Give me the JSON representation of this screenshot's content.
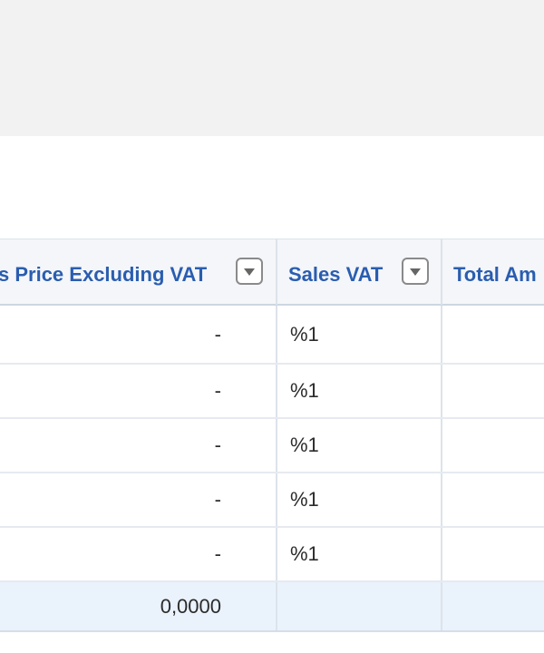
{
  "table": {
    "columns": [
      {
        "label": "s Price Excluding VAT"
      },
      {
        "label": "Sales VAT"
      },
      {
        "label": "Total Am"
      }
    ],
    "rows": [
      {
        "price": "-",
        "vat": "%1",
        "total": ""
      },
      {
        "price": "-",
        "vat": "%1",
        "total": ""
      },
      {
        "price": "-",
        "vat": "%1",
        "total": ""
      },
      {
        "price": "-",
        "vat": "%1",
        "total": ""
      },
      {
        "price": "-",
        "vat": "%1",
        "total": ""
      }
    ],
    "totals": {
      "price": "0,0000",
      "vat": "",
      "total": ""
    }
  },
  "icons": {
    "filter": "filter-dropdown-icon"
  },
  "colors": {
    "header_text": "#2a5db0",
    "total_row_bg": "#eaf2fb",
    "top_band_bg": "#f2f2f2"
  }
}
